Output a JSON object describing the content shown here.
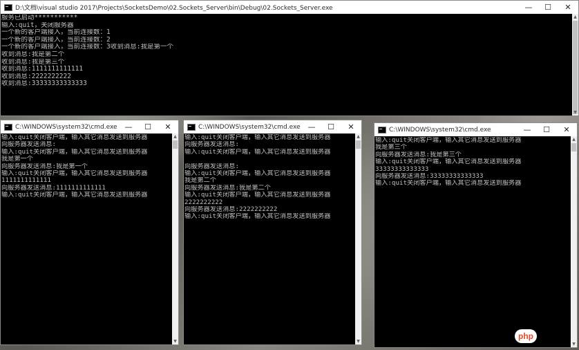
{
  "server_window": {
    "title": "D:\\文档\\visual studio 2017\\Projects\\SocketsDemo\\02.Sockets_Server\\bin\\Debug\\02.Sockets_Server.exe",
    "controls": {
      "minimize": "—",
      "maximize": "☐",
      "close": "✕"
    },
    "lines": [
      "服务已启动***********",
      "输入:quit，关闭服务器",
      "一个新的客户端接入，当前连接数：1",
      "一个新的客户端接入，当前连接数：2",
      "一个新的客户端接入，当前连接数：3收到消息:我是第一个",
      "收到消息:我是第二个",
      "收到消息:我是第三个",
      "收到消息:1111111111111",
      "收到消息:2222222222",
      "收到消息:33333333333333"
    ]
  },
  "client_windows": [
    {
      "title": "C:\\WINDOWS\\system32\\cmd.exe",
      "lines": [
        "输入:quit关闭客户端，输入其它消息发送到服务器",
        "向服务器发送消息:",
        "输入:quit关闭客户端，输入其它消息发送到服务器",
        "我是第一个",
        "向服务器发送消息:我是第一个",
        "输入:quit关闭客户端，输入其它消息发送到服务器",
        "1111111111111",
        "向服务器发送消息:1111111111111",
        "输入:quit关闭客户端，输入其它消息发送到服务器"
      ]
    },
    {
      "title": "C:\\WINDOWS\\system32\\cmd.exe",
      "lines": [
        "输入:quit关闭客户端，输入其它消息发送到服务器",
        "向服务器发送消息:",
        "输入:quit关闭客户端，输入其它消息发送到服务器",
        "",
        "向服务器发送消息:",
        "输入:quit关闭客户端，输入其它消息发送到服务器",
        "我是第二个",
        "向服务器发送消息:我是第二个",
        "输入:quit关闭客户端，输入其它消息发送到服务器",
        "2222222222",
        "向服务器发送消息:2222222222",
        "输入:quit关闭客户端，输入其它消息发送到服务器"
      ]
    },
    {
      "title": "C:\\WINDOWS\\system32\\cmd.exe",
      "lines": [
        "输入:quit关闭客户端，输入其它消息发送到服务器",
        "我是第三个",
        "向服务器发送消息:我是第三个",
        "输入:quit关闭客户端，输入其它消息发送到服务器",
        "33333333333333",
        "向服务器发送消息:33333333333333",
        "输入:quit关闭客户端，输入其它消息发送到服务器"
      ]
    }
  ],
  "scrollbar": {
    "up_glyph": "▲",
    "down_glyph": "▼"
  },
  "watermark": "php",
  "colors": {
    "console_bg": "#000000",
    "console_text": "#c0c0c0",
    "titlebar_bg": "#ffffff"
  }
}
